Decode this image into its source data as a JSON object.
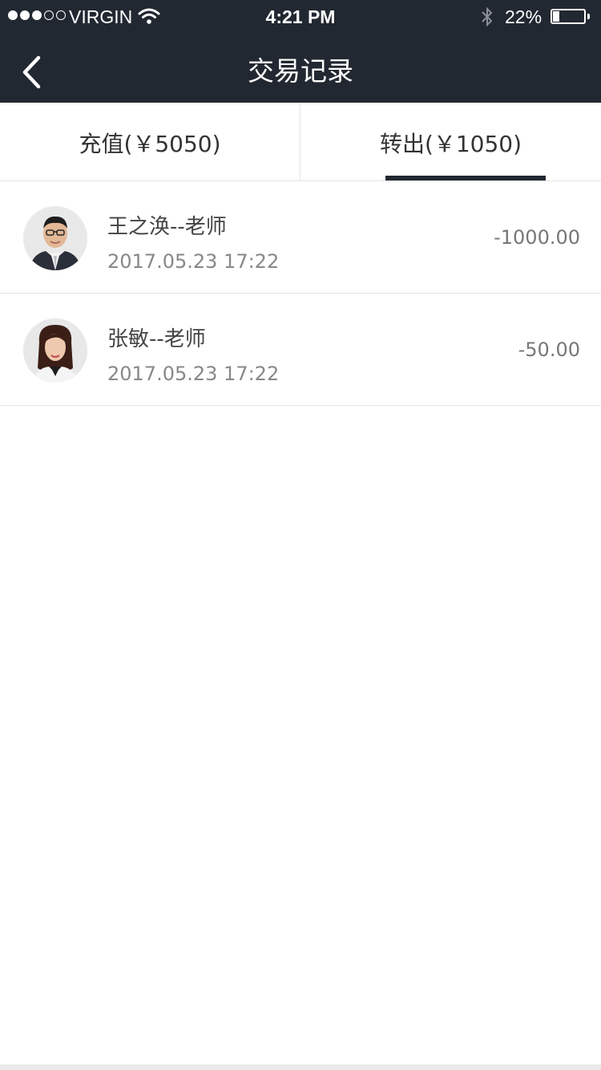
{
  "status_bar": {
    "carrier": "VIRGIN",
    "time": "4:21 PM",
    "battery_percent": "22%",
    "battery_level": 0.22,
    "signal_bars_filled": 3,
    "signal_bars_total": 5
  },
  "nav": {
    "title": "交易记录",
    "back_icon": "chevron-left-icon"
  },
  "tabs": [
    {
      "label": "充值(￥5050)",
      "active": false
    },
    {
      "label": "转出(￥1050)",
      "active": true
    }
  ],
  "transactions": [
    {
      "name": "王之涣--老师",
      "time": "2017.05.23 17:22",
      "amount": "-1000.00",
      "avatar": "male-teacher-avatar"
    },
    {
      "name": "张敏--老师",
      "time": "2017.05.23 17:22",
      "amount": "-50.00",
      "avatar": "female-teacher-avatar"
    }
  ],
  "colors": {
    "header_bg": "#222831",
    "divider": "#e5e5e5",
    "accent": "#222831"
  }
}
